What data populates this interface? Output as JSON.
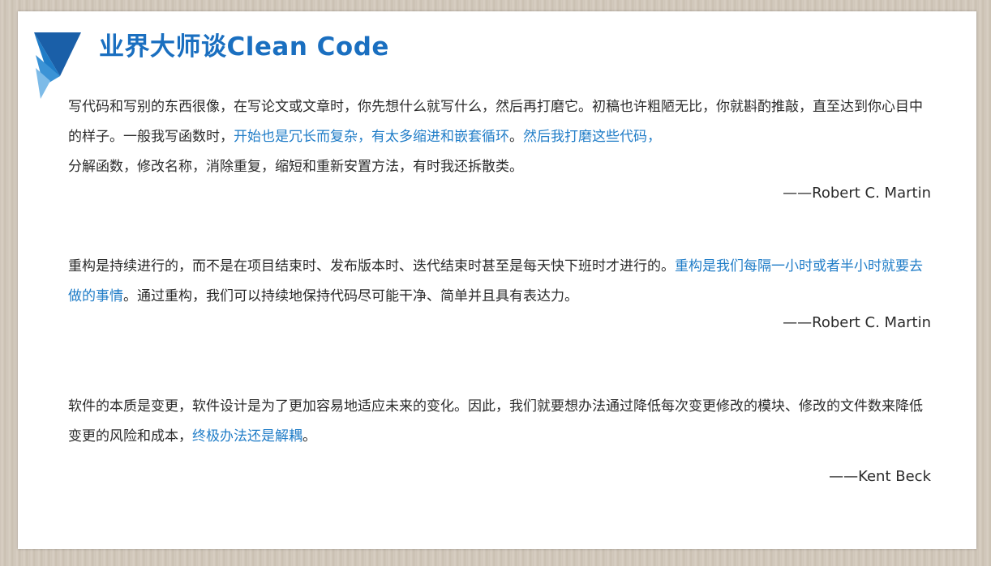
{
  "title": "业界大师谈Clean Code",
  "brand_color": "#1a6fc0",
  "highlight_color": "#1f7cc7",
  "logo": "blue-layered-triangles-logo",
  "quotes": [
    {
      "text_a": "写代码和写别的东西很像，在写论文或文章时，你先想什么就写什么，然后再打磨它。初稿也许粗陋无比，你就斟酌推敲，直至达到你心目中的样子。一般我写函数时，",
      "highlight_a": "开始也是冗长而复杂，有太多缩进和嵌套循环",
      "text_b": "。",
      "highlight_b": "然后我打磨这些代码，",
      "text_c": "分解函数，修改名称，消除重复，缩短和重新安置方法，有时我还拆散类。",
      "author": "——Robert C. Martin"
    },
    {
      "text_a": "重构是持续进行的，而不是在项目结束时、发布版本时、迭代结束时甚至是每天快下班时才进行的。",
      "highlight_a": "重构是我们每隔一小时或者半小时就要去做的事情",
      "text_b": "。通过重构，我们可以持续地保持代码尽可能干净、简单并且具有表达力。",
      "author": "——Robert C. Martin"
    },
    {
      "text_a": "软件的本质是变更，软件设计是为了更加容易地适应未来的变化。因此，我们就要想办法通过降低每次变更修改的模块、修改的文件数来降低变更的风险和成本，",
      "highlight_a": "终极办法还是解耦",
      "text_b": "。",
      "author": "——Kent Beck"
    }
  ]
}
